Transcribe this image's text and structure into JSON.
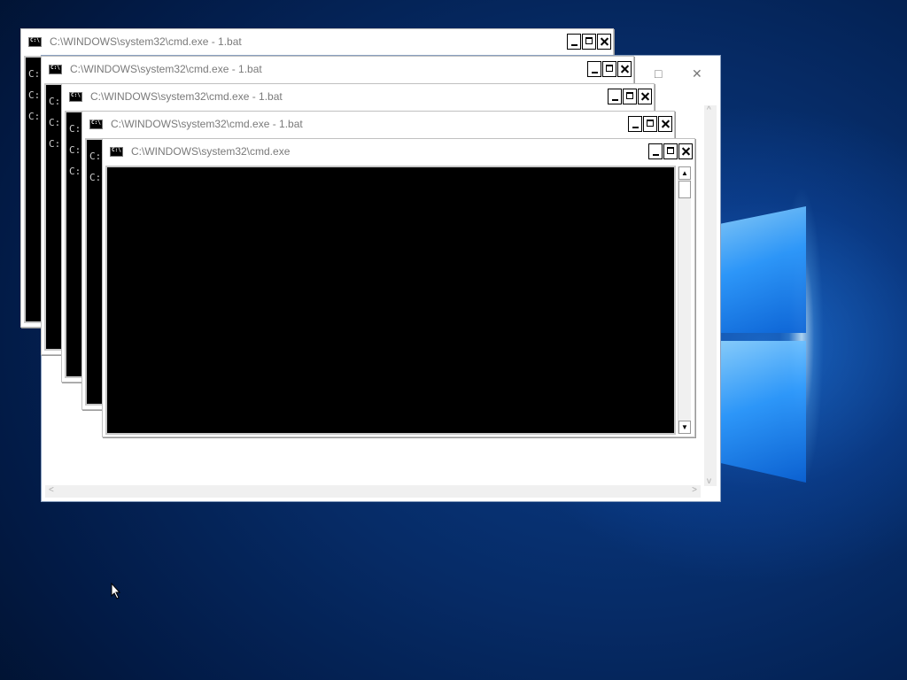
{
  "desktop": {
    "logo": "windows-logo",
    "colors": {
      "wallpaper": "#062b66",
      "accent": "#2f9cff"
    }
  },
  "windows": [
    {
      "title": "C:\\WINDOWS\\system32\\cmd.exe - 1.bat",
      "prompts": [
        "C:\\",
        "C:\\",
        "C:\\"
      ]
    },
    {
      "title": "C:\\WINDOWS\\system32\\cmd.exe - 1.bat",
      "prompts": [
        "C:\\",
        "C:\\",
        "C:\\"
      ]
    },
    {
      "title": "C:\\WINDOWS\\system32\\cmd.exe - 1.bat",
      "prompts": [
        "C:\\",
        "C:\\",
        "C:\\"
      ]
    },
    {
      "title": "C:\\WINDOWS\\system32\\cmd.exe - 1.bat",
      "prompts": [
        "C:\\",
        "C:\\"
      ]
    },
    {
      "title": "C:\\WINDOWS\\system32\\cmd.exe",
      "prompts": []
    }
  ],
  "modern_window": {
    "maximize_glyph": "□",
    "close_glyph": "✕"
  },
  "icons": {
    "minimize": "minimize-icon",
    "maximize": "maximize-icon",
    "close": "close-icon",
    "cmd": "cmd-app-icon",
    "cursor": "mouse-cursor-icon"
  }
}
